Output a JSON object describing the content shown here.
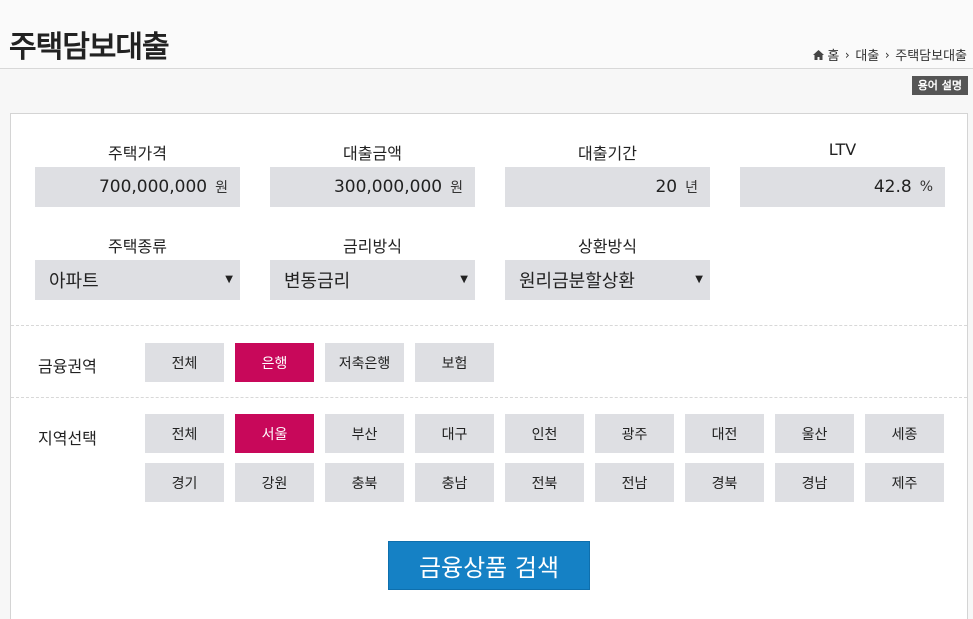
{
  "header": {
    "title": "주택담보대출",
    "breadcrumb": [
      "홈",
      "대출",
      "주택담보대출"
    ],
    "glossary_label": "용어 설명"
  },
  "inputs": {
    "house_price": {
      "label": "주택가격",
      "value": "700,000,000",
      "unit": "원"
    },
    "loan_amount": {
      "label": "대출금액",
      "value": "300,000,000",
      "unit": "원"
    },
    "loan_term": {
      "label": "대출기간",
      "value": "20",
      "unit": "년"
    },
    "ltv": {
      "label": "LTV",
      "value": "42.8",
      "unit": "%"
    }
  },
  "selects": {
    "house_type": {
      "label": "주택종류",
      "selected": "아파트"
    },
    "rate_type": {
      "label": "금리방식",
      "selected": "변동금리"
    },
    "repay_type": {
      "label": "상환방식",
      "selected": "원리금분할상환"
    }
  },
  "finance_sector": {
    "label": "금융권역",
    "options": [
      "전체",
      "은행",
      "저축은행",
      "보험"
    ],
    "selected": "은행"
  },
  "region": {
    "label": "지역선택",
    "row1": [
      "전체",
      "서울",
      "부산",
      "대구",
      "인천",
      "광주",
      "대전",
      "울산",
      "세종"
    ],
    "row2": [
      "경기",
      "강원",
      "충북",
      "충남",
      "전북",
      "전남",
      "경북",
      "경남",
      "제주"
    ],
    "selected": "서울"
  },
  "search_button": "금융상품 검색",
  "colors": {
    "active": "#c8085a",
    "primary_button": "#1581c5",
    "field_bg": "#dedfe3"
  }
}
